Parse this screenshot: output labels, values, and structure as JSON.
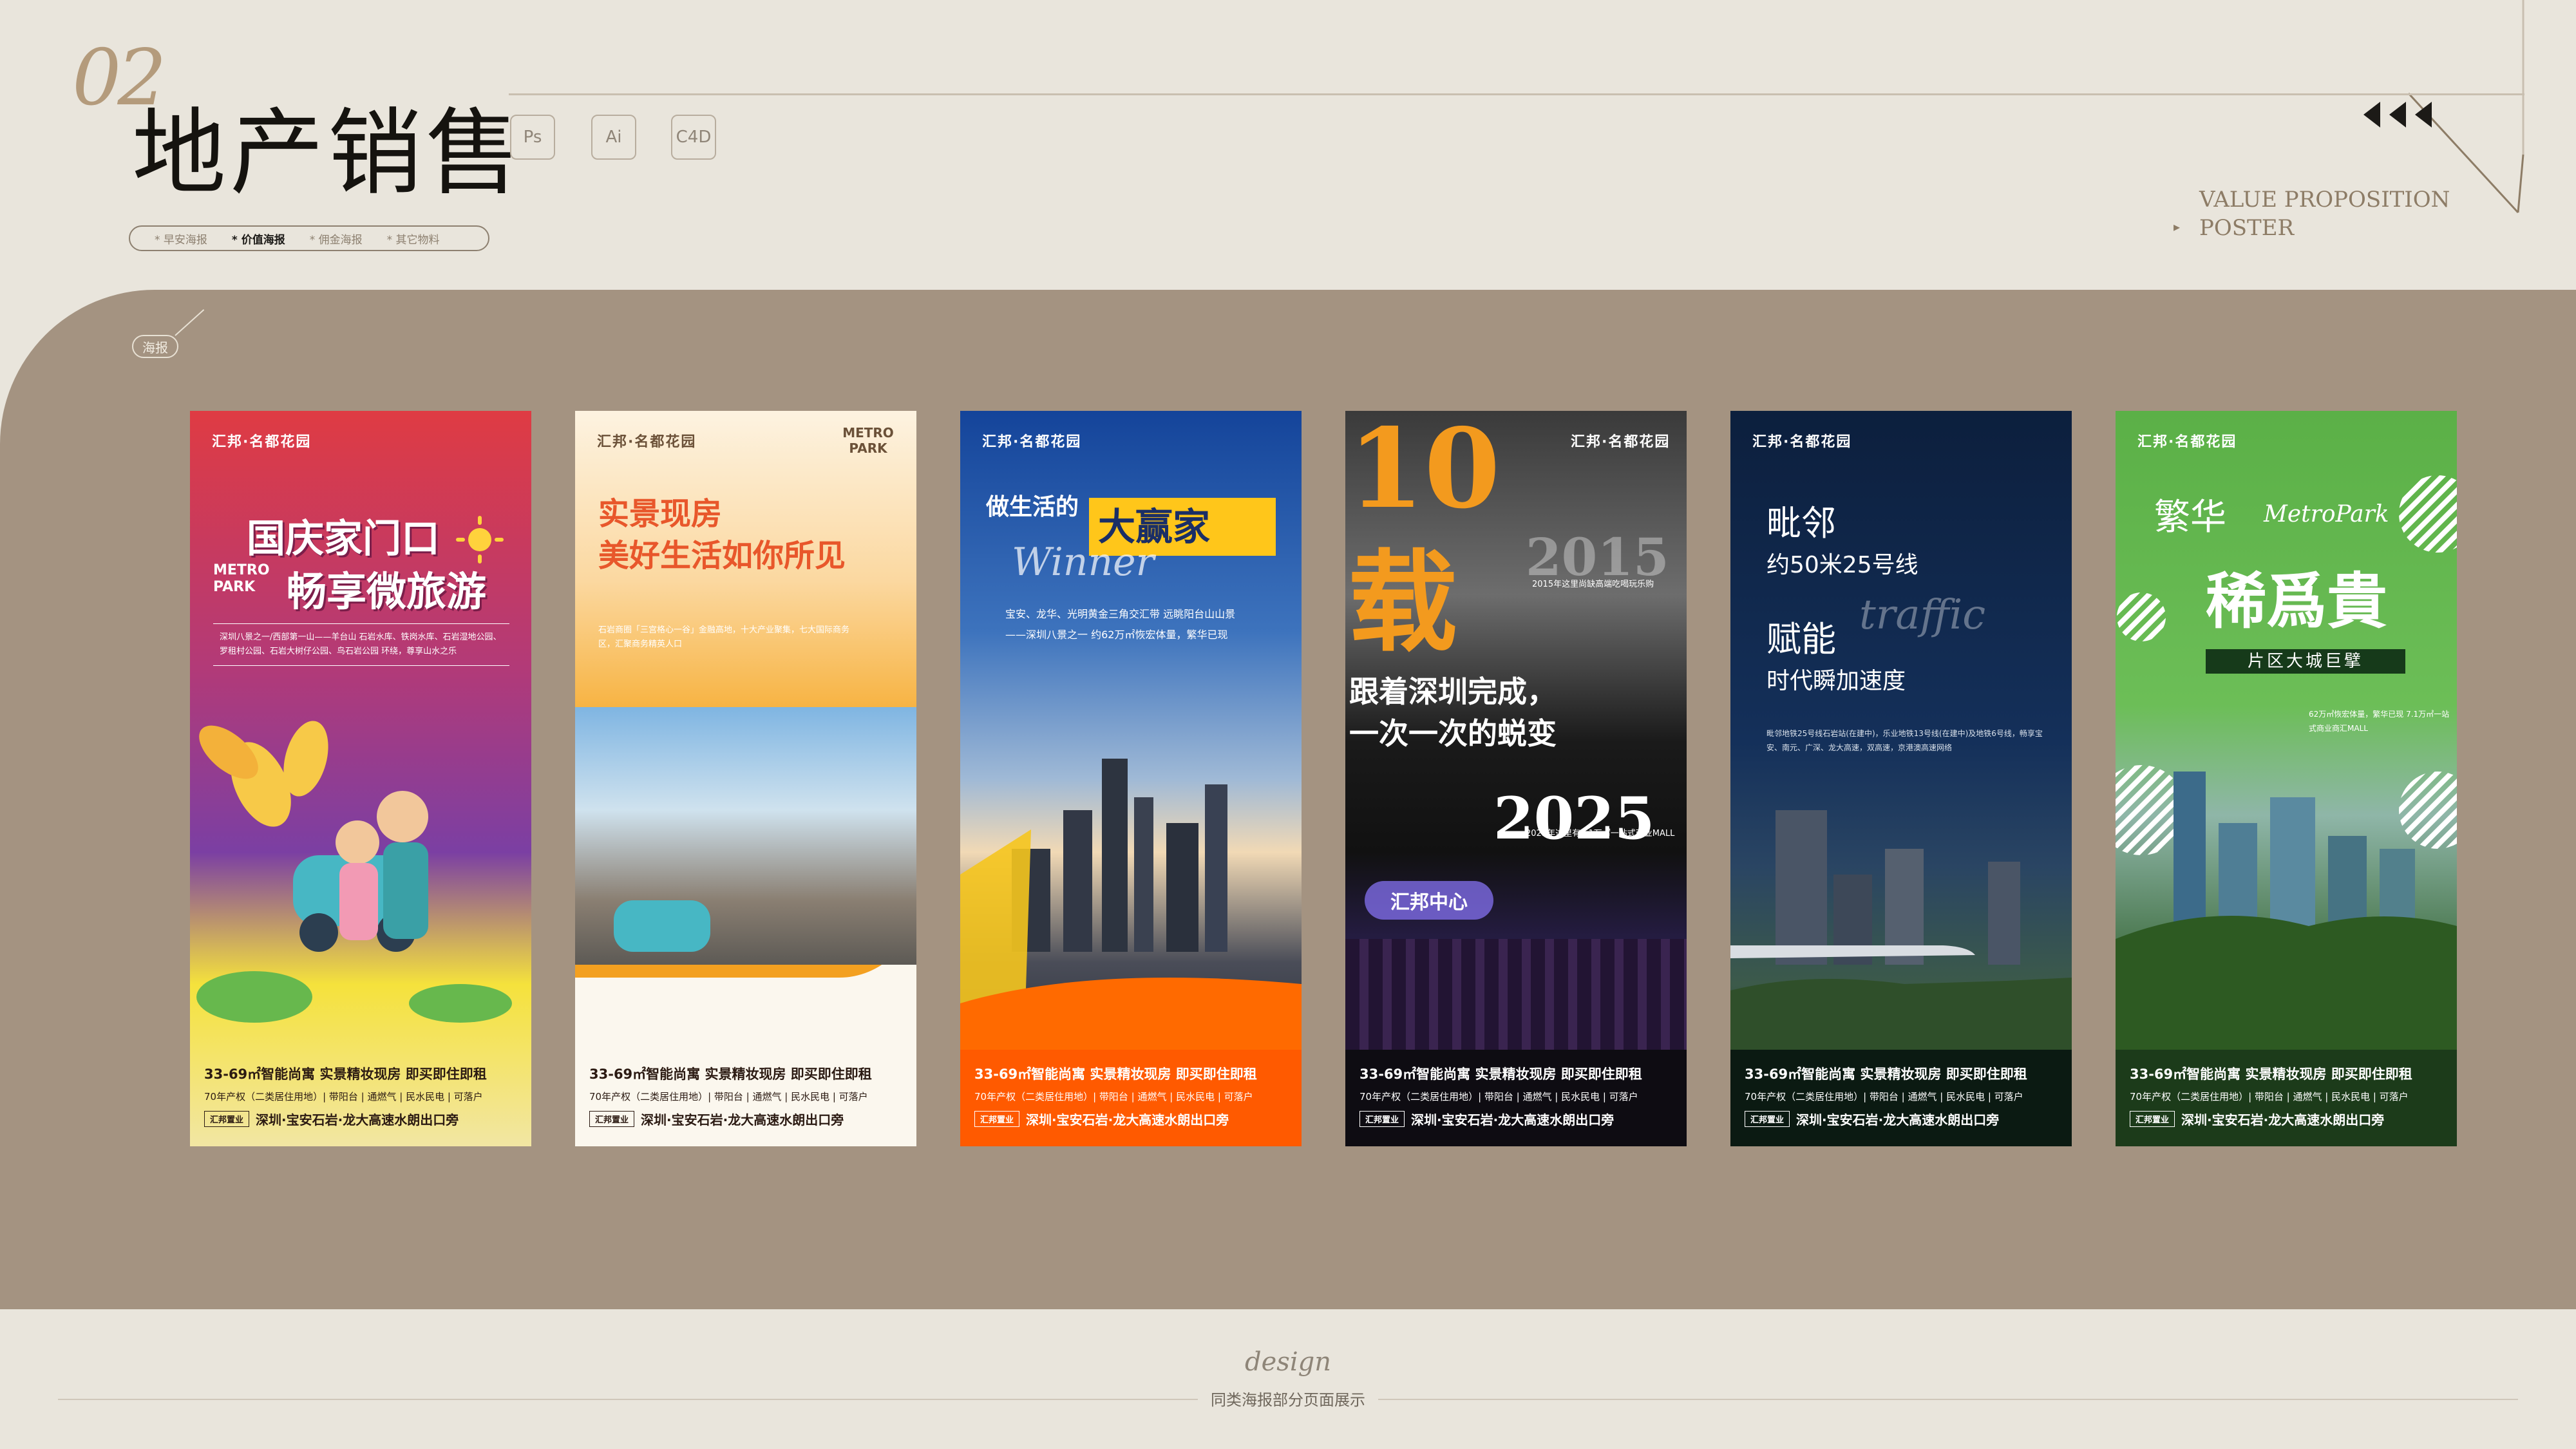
{
  "header": {
    "section_number": "02",
    "title": "地产销售",
    "tools": [
      "Ps",
      "Ai",
      "C4D"
    ],
    "subtitle_lines": [
      "VALUE PROPOSITION",
      "POSTER"
    ]
  },
  "categories": [
    "* 早安海报",
    "* 价值海报",
    "* 佣金海报",
    "* 其它物料"
  ],
  "band_tag": "海报",
  "posters": [
    {
      "logo": "汇邦·名都花园",
      "headline": "国庆家门口",
      "headline2": "畅享微旅游",
      "tag": "METRO PARK",
      "body": "深圳八景之一/西部第一山——羊台山 石岩水库、铁岗水库、石岩湿地公园、罗租村公园、石岩大树仔公园、鸟石岩公园 环绕，尊享山水之乐",
      "foot1": "33-69㎡智能尚寓 实景精妆现房 即买即住即租",
      "foot2": "70年产权（二类居住用地）| 带阳台 | 通燃气 | 民水民电 | 可落户",
      "foot3": "深圳·宝安石岩·龙大高速水朗出口旁",
      "brand": "汇邦置业"
    },
    {
      "logo": "汇邦·名都花园",
      "tag": "METRO PARK",
      "headline": "实景现房",
      "headline2": "美好生活如你所见",
      "body": "石岩商圈「三宫格心一谷」金融高地，十大产业聚集，七大国际商务区，汇聚商务精英人口",
      "foot1": "33-69㎡智能尚寓 实景精妆现房 即买即住即租",
      "foot2": "70年产权（二类居住用地）| 带阳台 | 通燃气 | 民水民电 | 可落户",
      "foot3": "深圳·宝安石岩·龙大高速水朗出口旁",
      "brand": "汇邦置业"
    },
    {
      "logo": "汇邦·名都花园",
      "headline": "做生活的",
      "headline2": "大赢家",
      "script": "Winner",
      "body": "宝安、龙华、光明黄金三角交汇带 远眺阳台山山景——深圳八景之一 约62万㎡恢宏体量，繁华已现",
      "foot1": "33-69㎡智能尚寓 实景精妆现房 即买即住即租",
      "foot2": "70年产权（二类居住用地）| 带阳台 | 通燃气 | 民水民电 | 可落户",
      "foot3": "深圳·宝安石岩·龙大高速水朗出口旁",
      "brand": "汇邦置业"
    },
    {
      "logo": "汇邦·名都花园",
      "big_num": "10",
      "big_char": "载",
      "year1": "2015",
      "year2": "2025",
      "caption1": "2015年这里尚缺高端吃喝玩乐购",
      "headline": "跟着深圳完成，",
      "headline2": "一次一次的蜕变",
      "caption2": "2025年这里有7.1万㎡一站式商业MALL",
      "mall": "汇邦中心",
      "foot1": "33-69㎡智能尚寓 实景精妆现房 即买即住即租",
      "foot2": "70年产权（二类居住用地）| 带阳台 | 通燃气 | 民水民电 | 可落户",
      "foot3": "深圳·宝安石岩·龙大高速水朗出口旁",
      "brand": "汇邦置业"
    },
    {
      "logo": "汇邦·名都花园",
      "headline": "毗邻",
      "sub1": "约50米25号线",
      "headline2": "赋能",
      "sub2": "时代瞬加速度",
      "script": "traffic",
      "body": "毗邻地铁25号线石岩站(在建中)，乐业地铁13号线(在建中)及地铁6号线，畅享宝安、南元、广深、龙大高速，双高速，京港澳高速网络",
      "foot1": "33-69㎡智能尚寓 实景精妆现房 即买即住即租",
      "foot2": "70年产权（二类居住用地）| 带阳台 | 通燃气 | 民水民电 | 可落户",
      "foot3": "深圳·宝安石岩·龙大高速水朗出口旁",
      "brand": "汇邦置业"
    },
    {
      "logo": "汇邦·名都花园",
      "headline": "繁华",
      "script": "MetroPark",
      "headline2": "稀爲貴",
      "banner": "片区大城巨擘",
      "body": "62万㎡恢宏体量，繁华已现 7.1万㎡一站式商业商汇MALL",
      "foot1": "33-69㎡智能尚寓 实景精妆现房 即买即住即租",
      "foot2": "70年产权（二类居住用地）| 带阳台 | 通燃气 | 民水民电 | 可落户",
      "foot3": "深圳·宝安石岩·龙大高速水朗出口旁",
      "brand": "汇邦置业"
    }
  ],
  "footer": {
    "design_word": "design",
    "caption": "同类海报部分页面展示"
  },
  "colors": {
    "page_bg": "#e9e5dc",
    "band": "#a49381",
    "accent": "#b49b7c"
  }
}
